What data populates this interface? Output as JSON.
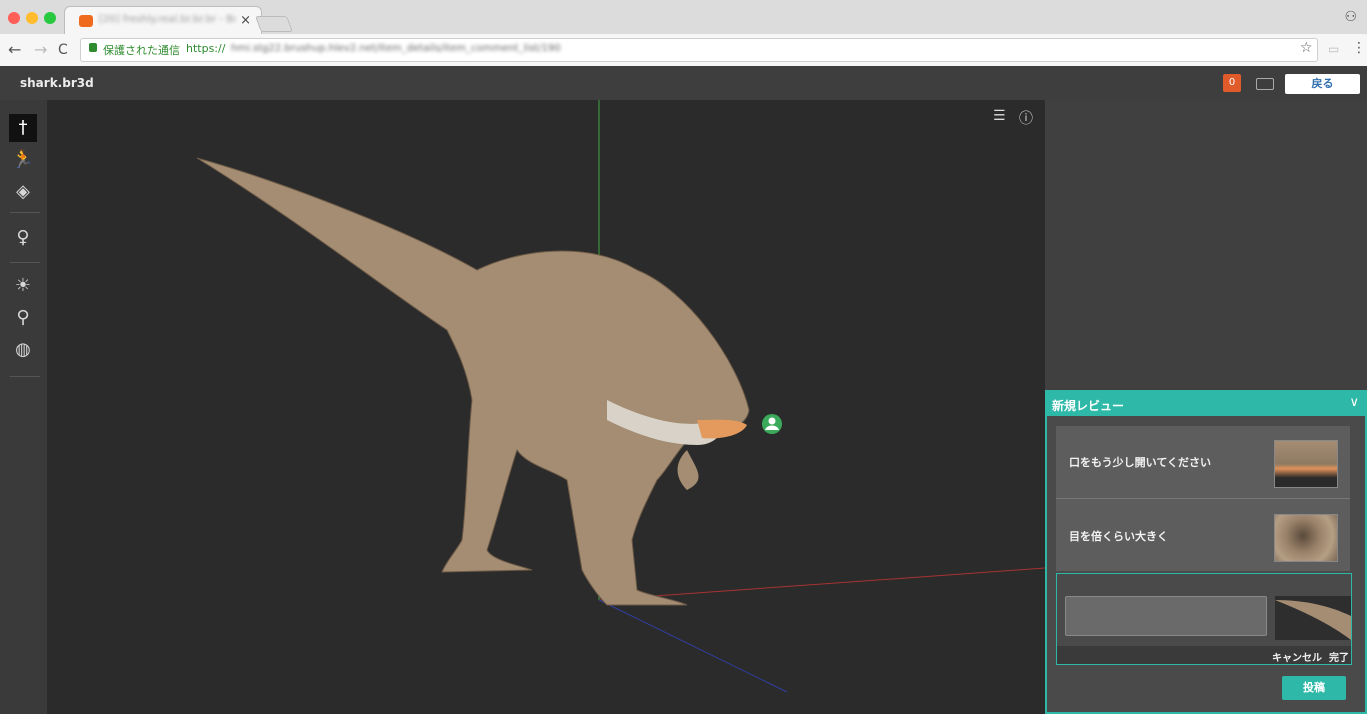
{
  "browser": {
    "tab_title": "[20] freshly.real.br.br.br - Br...",
    "tab_close": "×",
    "back_icon": "←",
    "forward_icon": "→",
    "reload_icon": "C",
    "secure_label": "保護された通信",
    "url_protocol": "https://",
    "url_rest": "hmi.stg22.brushup.hlev2.net/item_details/item_comment_list/1903",
    "star_icon": "☆",
    "ext_icon": "▭",
    "menu_icon": "⋮",
    "profile_icon": "⚇",
    "traffic_colors": [
      "#ff5f57",
      "#febc2e",
      "#28c840"
    ]
  },
  "app": {
    "file_name": "shark.br3d",
    "notification_count": "0",
    "back_button": "戻る"
  },
  "toolbar": {
    "items": [
      {
        "name": "transform-tool",
        "glyph": "†"
      },
      {
        "name": "animation-tool",
        "glyph": "🏃"
      },
      {
        "name": "texture-tool",
        "glyph": "◈"
      },
      {
        "name": "light-tool",
        "glyph": "♀"
      },
      {
        "name": "exposure-tool",
        "glyph": "☀"
      },
      {
        "name": "pin-tool",
        "glyph": "⚲"
      },
      {
        "name": "globe-tool",
        "glyph": "◍"
      }
    ]
  },
  "viewport": {
    "outline_icon": "☰",
    "info_icon": "ⓘ",
    "user_marker_icon": "☺"
  },
  "review": {
    "title": "新規レビュー",
    "chevron": "∨",
    "comments": [
      {
        "text": "口をもう少し開いてください"
      },
      {
        "text": "目を倍くらい大きく"
      }
    ],
    "cancel": "キャンセル",
    "done": "完了",
    "post": "投稿"
  }
}
